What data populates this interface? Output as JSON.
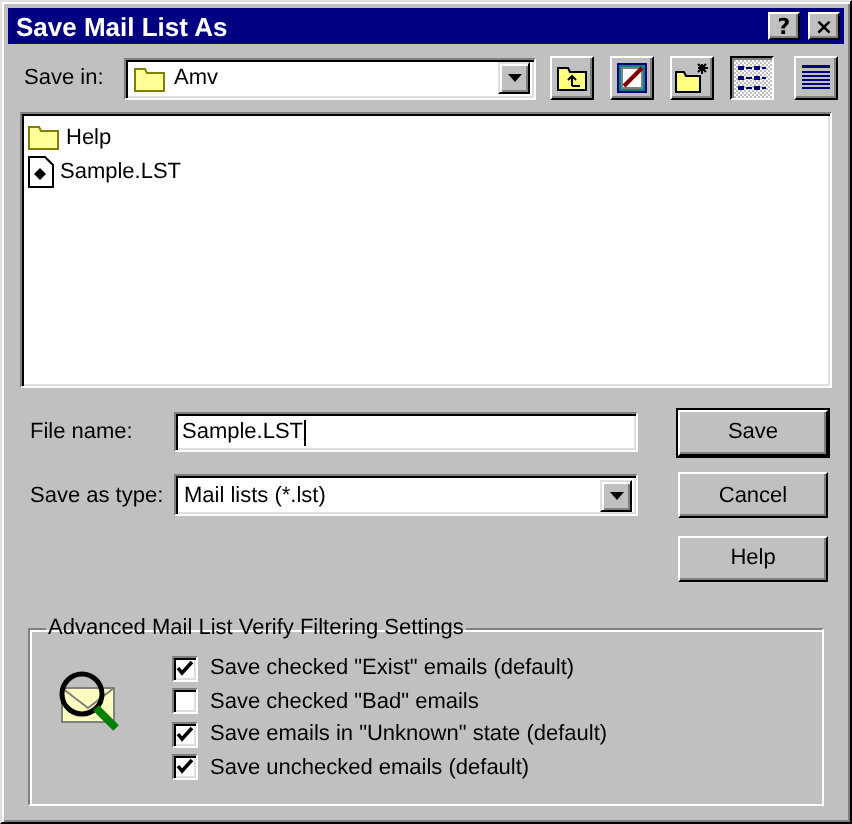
{
  "window": {
    "title": "Save Mail List As",
    "title_buttons": [
      "?",
      "×"
    ]
  },
  "save_in": {
    "label": "Save in:",
    "value": "Amv"
  },
  "toolbar": [
    {
      "kind": "up"
    },
    {
      "kind": "desktop"
    },
    {
      "kind": "newfolder"
    },
    {
      "kind": "list",
      "selected": true
    },
    {
      "kind": "details",
      "selected": false
    }
  ],
  "files": [
    {
      "kind": "folder",
      "name": "Help"
    },
    {
      "kind": "file",
      "name": "Sample.LST"
    }
  ],
  "file_name": {
    "label": "File name:",
    "value": "Sample.LST"
  },
  "save_as_type": {
    "label": "Save as type:",
    "value": "Mail lists (*.lst)"
  },
  "buttons": [
    {
      "label": "Save",
      "default": true
    },
    {
      "label": "Cancel",
      "default": false
    },
    {
      "label": "Help",
      "default": false
    }
  ],
  "filter_group": {
    "title": "Advanced Mail List Verify Filtering Settings",
    "options": [
      {
        "label": "Save checked \"Exist\" emails (default)",
        "checked": true
      },
      {
        "label": "Save checked \"Bad\" emails",
        "checked": false
      },
      {
        "label": "Save emails in \"Unknown\" state (default)",
        "checked": true
      },
      {
        "label": "Save unchecked emails (default)",
        "checked": true
      }
    ]
  }
}
